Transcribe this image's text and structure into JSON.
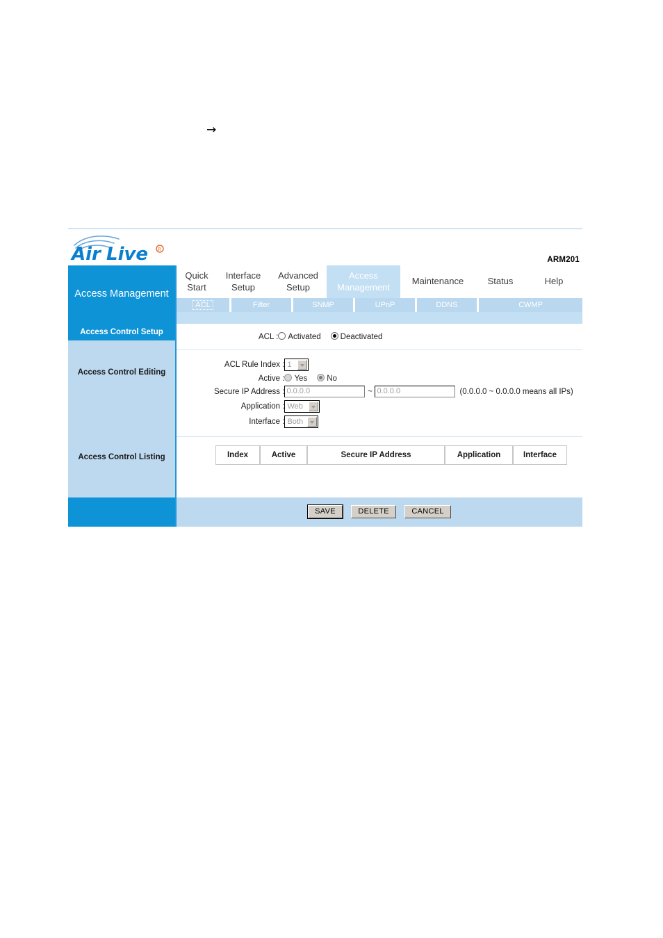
{
  "page": {
    "arrow_glyph": "→"
  },
  "header": {
    "brand": "AirLive",
    "brand_air": "Air",
    "brand_live": "Live",
    "registered_mark": "®",
    "model": "ARM201"
  },
  "section": {
    "title": "Access\nManagement"
  },
  "tabs": [
    {
      "label": "Quick\nStart",
      "active": false
    },
    {
      "label": "Interface\nSetup",
      "active": false
    },
    {
      "label": "Advanced\nSetup",
      "active": false
    },
    {
      "label": "Access\nManagement",
      "active": true
    },
    {
      "label": "Maintenance",
      "active": false
    },
    {
      "label": "Status",
      "active": false
    },
    {
      "label": "Help",
      "active": false
    }
  ],
  "subtabs": [
    {
      "label": "ACL",
      "selected": true
    },
    {
      "label": "Filter",
      "selected": false
    },
    {
      "label": "SNMP",
      "selected": false
    },
    {
      "label": "UPnP",
      "selected": false
    },
    {
      "label": "DDNS",
      "selected": false
    },
    {
      "label": "CWMP",
      "selected": false
    }
  ],
  "sidebar": {
    "items": [
      {
        "label": "Access Control Setup",
        "current": true
      },
      {
        "label": "Access Control Editing",
        "current": false
      },
      {
        "label": "Access Control Listing",
        "current": false
      }
    ]
  },
  "setup": {
    "acl_label": "ACL :",
    "activated_label": "Activated",
    "deactivated_label": "Deactivated",
    "activated_selected": false,
    "deactivated_selected": true
  },
  "editing": {
    "rule_index_label": "ACL Rule Index :",
    "rule_index_value": "1",
    "active_label": "Active :",
    "active_yes_label": "Yes",
    "active_no_label": "No",
    "active_yes_selected": false,
    "active_no_selected": true,
    "secure_ip_label": "Secure IP Address :",
    "secure_ip_from": "0.0.0.0",
    "secure_ip_to": "0.0.0.0",
    "range_separator": "~",
    "secure_ip_hint": "(0.0.0.0 ~ 0.0.0.0 means all IPs)",
    "application_label": "Application :",
    "application_value": "Web",
    "interface_label": "Interface :",
    "interface_value": "Both"
  },
  "listing": {
    "columns": [
      "Index",
      "Active",
      "Secure IP Address",
      "Application",
      "Interface"
    ],
    "rows": []
  },
  "footer": {
    "save_label": "SAVE",
    "delete_label": "DELETE",
    "cancel_label": "CANCEL"
  },
  "colors": {
    "brand_blue": "#0f93d7",
    "tab_active_blue": "#c3dff3",
    "sidebar_blue": "#bcd9ef",
    "subtab_blue": "#b9d7ee",
    "divider_blue": "#cfe4f4",
    "button_face": "#d4d0c8"
  }
}
